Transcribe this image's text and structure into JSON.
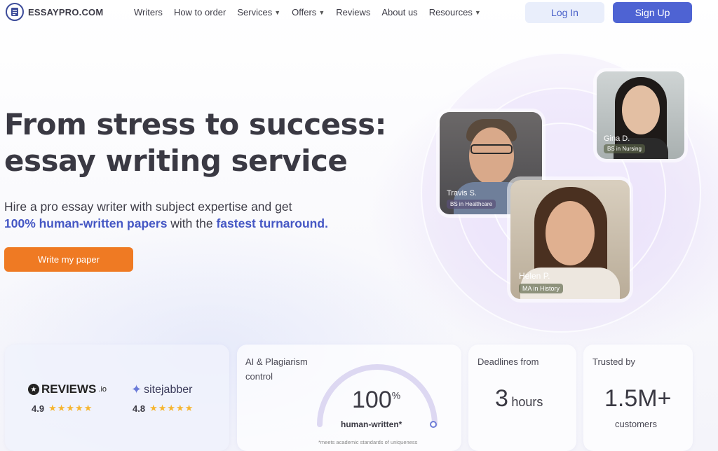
{
  "brand": {
    "name": "ESSAYPRO.COM"
  },
  "nav": [
    {
      "label": "Writers",
      "dropdown": false
    },
    {
      "label": "How to order",
      "dropdown": false
    },
    {
      "label": "Services",
      "dropdown": true
    },
    {
      "label": "Offers",
      "dropdown": true
    },
    {
      "label": "Reviews",
      "dropdown": false
    },
    {
      "label": "About us",
      "dropdown": false
    },
    {
      "label": "Resources",
      "dropdown": true
    }
  ],
  "auth": {
    "login_label": "Log In",
    "signup_label": "Sign Up"
  },
  "hero": {
    "title_line1": "From stress to success:",
    "title_line2": "essay writing service",
    "subtitle_part1": "Hire a pro essay writer with subject expertise and get",
    "subtitle_highlight1": "100% human-written papers",
    "subtitle_part2": " with the ",
    "subtitle_highlight2": "fastest turnaround.",
    "cta_label": "Write my paper"
  },
  "writers": [
    {
      "name": "Travis S.",
      "degree": "BS in Healthcare"
    },
    {
      "name": "Gina D.",
      "degree": "BS in Nursing"
    },
    {
      "name": "Helen P.",
      "degree": "MA in History"
    }
  ],
  "stats": {
    "reviews": [
      {
        "site": "REVIEWS",
        "suffix": ".io",
        "score": "4.9",
        "stars": "★★★★★"
      },
      {
        "site": "sitejabber",
        "suffix": "",
        "score": "4.8",
        "stars": "★★★★★"
      }
    ],
    "ai": {
      "label_line1": "AI & Plagiarism",
      "label_line2": "control",
      "value": "100",
      "unit": "%",
      "caption": "human-written*",
      "footnote": "*meets academic standards of uniqueness",
      "gauge_fraction": 1.0
    },
    "deadline": {
      "label": "Deadlines from",
      "value": "3",
      "unit": "hours"
    },
    "trusted": {
      "label": "Trusted by",
      "value": "1.5M+",
      "caption": "customers"
    }
  },
  "colors": {
    "primary": "#4e63d3",
    "accent": "#ef7a23",
    "highlight": "#4557c4",
    "star": "#f6b52f"
  }
}
